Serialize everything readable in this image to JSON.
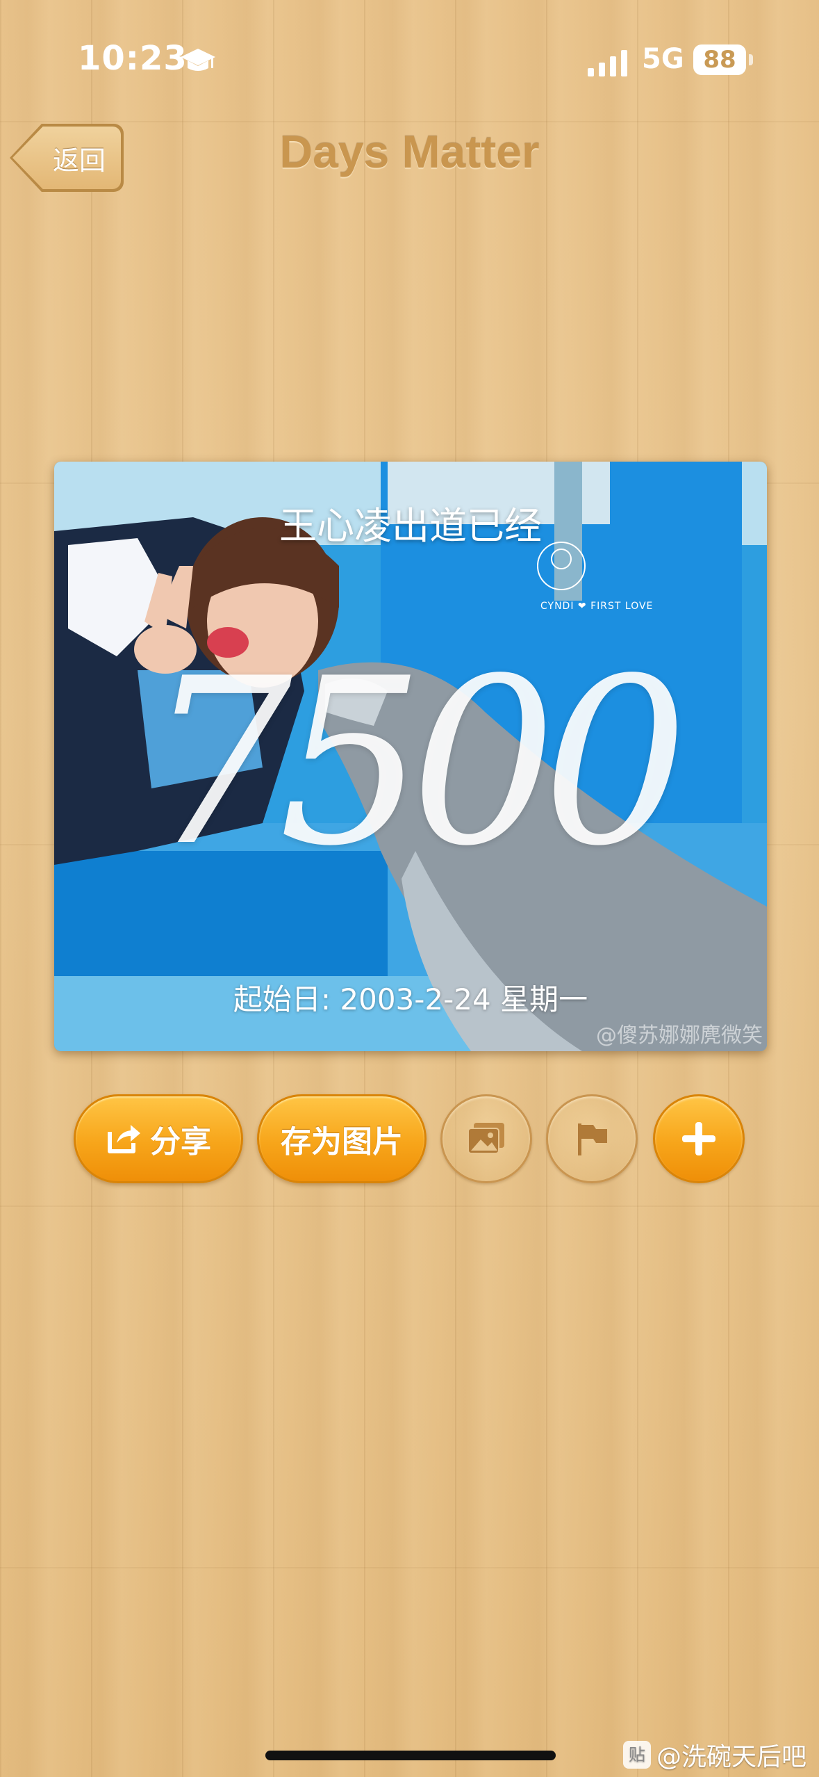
{
  "status_bar": {
    "time": "10:23",
    "network": "5G",
    "battery": "88"
  },
  "nav": {
    "back_label": "返回",
    "title": "Days Matter"
  },
  "card": {
    "title": "王心凌出道已经",
    "day_count": "7500",
    "start_date": "起始日: 2003-2-24 星期一",
    "logo_text": "CYNDI ❤ FIRST LOVE",
    "watermark": "@傻苏娜娜麂微笑"
  },
  "actions": {
    "share_label": "分享",
    "save_image_label": "存为图片"
  },
  "footer": {
    "forum_logo": "贴",
    "forum_watermark": "@洗碗天后吧"
  },
  "icons": [
    "graduation-cap-icon",
    "signal-icon",
    "share-icon",
    "photo-icon",
    "flag-icon",
    "plus-icon"
  ],
  "colors": {
    "accent": "#f7a51a",
    "title": "#c9964f",
    "wood": "#e6bf84"
  }
}
